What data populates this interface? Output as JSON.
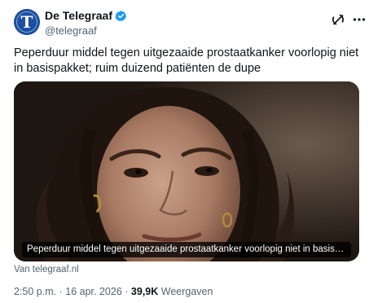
{
  "account": {
    "display_name": "De Telegraaf",
    "handle": "@telegraaf",
    "verified": true,
    "avatar_letter": "T"
  },
  "tweet": {
    "text": "Peperduur middel tegen uitgezaaide prostaatkanker voorlopig niet in basispakket; ruim duizend patiënten de dupe"
  },
  "link_card": {
    "caption": "Peperduur middel tegen uitgezaaide prostaatkanker voorlopig niet in basispakket; rui...",
    "source": "Van telegraaf.nl"
  },
  "meta": {
    "time": "2:50 p.m.",
    "separator": "·",
    "date": "16 apr. 2026",
    "views_count": "39,9K",
    "views_label": "Weergaven"
  },
  "colors": {
    "brand_blue": "#1d9bf0",
    "avatar_bg": "#1c4fa0",
    "text_primary": "#0f1419",
    "text_secondary": "#536471"
  },
  "icons": {
    "verified": "verified-badge-icon",
    "grok": "grok-icon",
    "more": "more-options-icon"
  }
}
